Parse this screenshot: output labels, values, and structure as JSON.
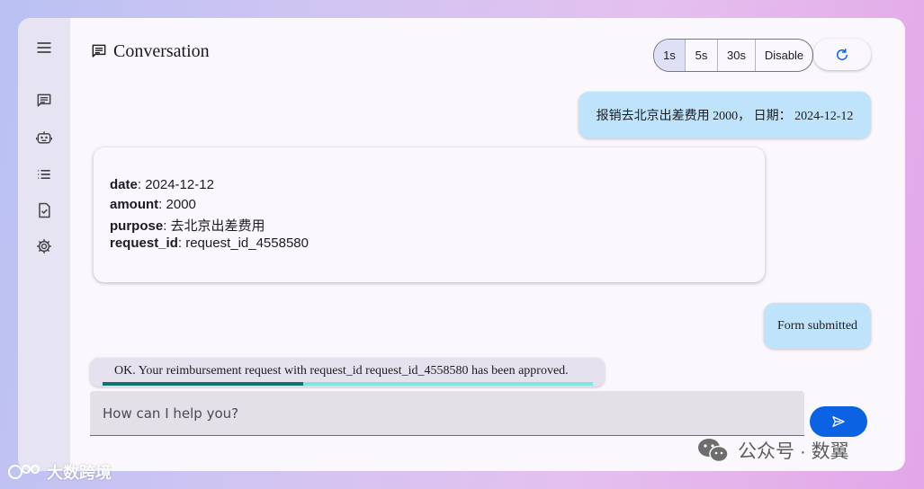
{
  "header": {
    "title": "Conversation",
    "title_icon": "chat-icon"
  },
  "nav_rail": [
    {
      "name": "menu-icon"
    },
    {
      "name": "chat-icon"
    },
    {
      "name": "robot-icon"
    },
    {
      "name": "list-icon"
    },
    {
      "name": "task-check-icon"
    },
    {
      "name": "settings-icon"
    }
  ],
  "refresh_interval": {
    "options": [
      "1s",
      "5s",
      "30s",
      "Disable"
    ],
    "selected": "1s"
  },
  "messages": {
    "user_1": "报销去北京出差费用 2000， 日期： 2024-12-12",
    "form": {
      "date_key": "date",
      "date_value": "2024-12-12",
      "amount_key": "amount",
      "amount_value": "2000",
      "purpose_key": "purpose",
      "purpose_value": "去北京出差费用",
      "request_id_key": "request_id",
      "request_id_value": "request_id_4558580"
    },
    "user_2": "Form submitted",
    "assistant_reply": "OK. Your reimbursement request with request_id request_id_4558580 has been approved.",
    "reply_progress": 0.41
  },
  "composer": {
    "placeholder": "How can I help you?",
    "send_icon": "send-icon"
  },
  "watermarks": {
    "left": "大数跨境",
    "right": "公众号 · 数翼"
  },
  "colors": {
    "user_bubble": "#bfe3fb",
    "send_button": "#0b62e3",
    "progress_fill": "#0e7470",
    "progress_track": "#7ee6dc",
    "segment_active": "#dee0f5"
  }
}
